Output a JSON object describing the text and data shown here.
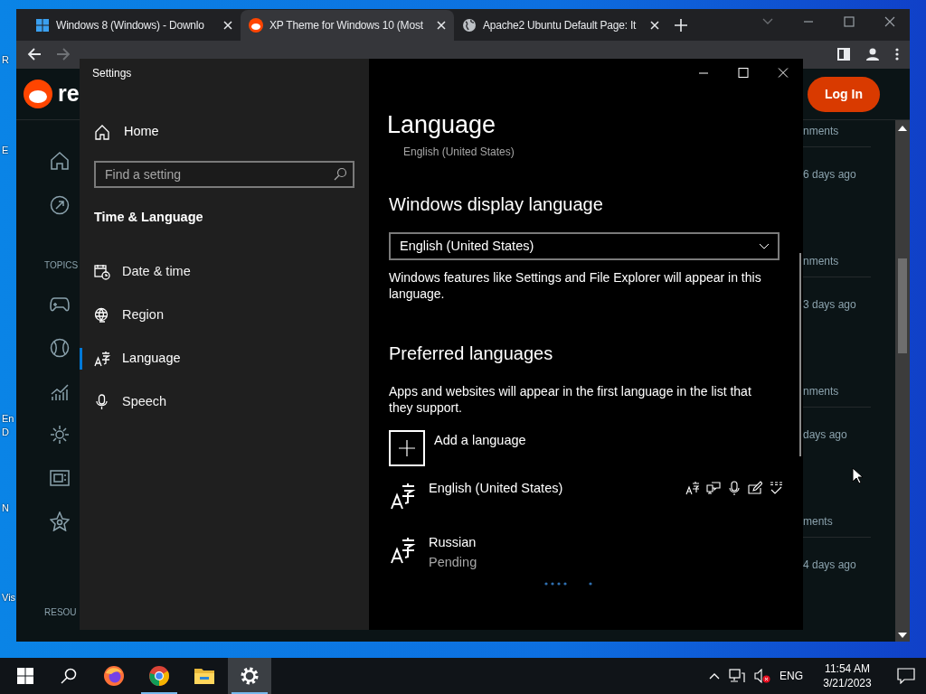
{
  "desktop": {
    "icon_labels": [
      "R",
      "E",
      "En",
      "D",
      "N",
      "Vis"
    ]
  },
  "browser": {
    "tabs": [
      {
        "kind": "windows",
        "title": "Windows 8 (Windows) - Downlo",
        "selected": false
      },
      {
        "kind": "reddit",
        "title": "XP Theme for Windows 10 (Most",
        "selected": true
      },
      {
        "kind": "globe",
        "title": "Apache2 Ubuntu Default Page: It",
        "selected": false
      }
    ],
    "page": {
      "logo_text": "re",
      "login": "Log In",
      "topics_heading": "TOPICS",
      "resources_heading": "RESOU",
      "posts": [
        {
          "comments": "nments",
          "age": "6 days ago"
        },
        {
          "comments": "nments",
          "age": "3 days ago"
        },
        {
          "comments": "nments",
          "age": "days ago"
        },
        {
          "comments": "ments",
          "age": "4 days ago"
        }
      ]
    }
  },
  "settings": {
    "title": "Settings",
    "home": "Home",
    "search_placeholder": "Find a setting",
    "category": "Time & Language",
    "nav": [
      {
        "kind": "date",
        "label": "Date & time",
        "selected": false
      },
      {
        "kind": "region",
        "label": "Region",
        "selected": false
      },
      {
        "kind": "language",
        "label": "Language",
        "selected": true
      },
      {
        "kind": "speech",
        "label": "Speech",
        "selected": false
      }
    ],
    "heading": "Language",
    "scrolled_text": "English (United States)",
    "display_language": {
      "heading": "Windows display language",
      "value": "English (United States)",
      "note": "Windows features like Settings and File Explorer will appear in this language."
    },
    "preferred": {
      "heading": "Preferred languages",
      "note": "Apps and websites will appear in the first language in the list that they support.",
      "add_label": "Add a language",
      "languages": [
        {
          "name": "English (United States)",
          "features": true,
          "installing": false
        },
        {
          "name": "Russian",
          "status": "Pending",
          "features": false,
          "installing": true
        }
      ]
    }
  },
  "taskbar": {
    "apps": [
      {
        "kind": "firefox",
        "running": false,
        "selected": false
      },
      {
        "kind": "chrome",
        "running": true,
        "selected": false
      },
      {
        "kind": "explorer",
        "running": false,
        "selected": false
      },
      {
        "kind": "settings",
        "running": true,
        "selected": true
      }
    ],
    "language": "ENG",
    "time": "11:54 AM",
    "date": "3/21/2023"
  }
}
